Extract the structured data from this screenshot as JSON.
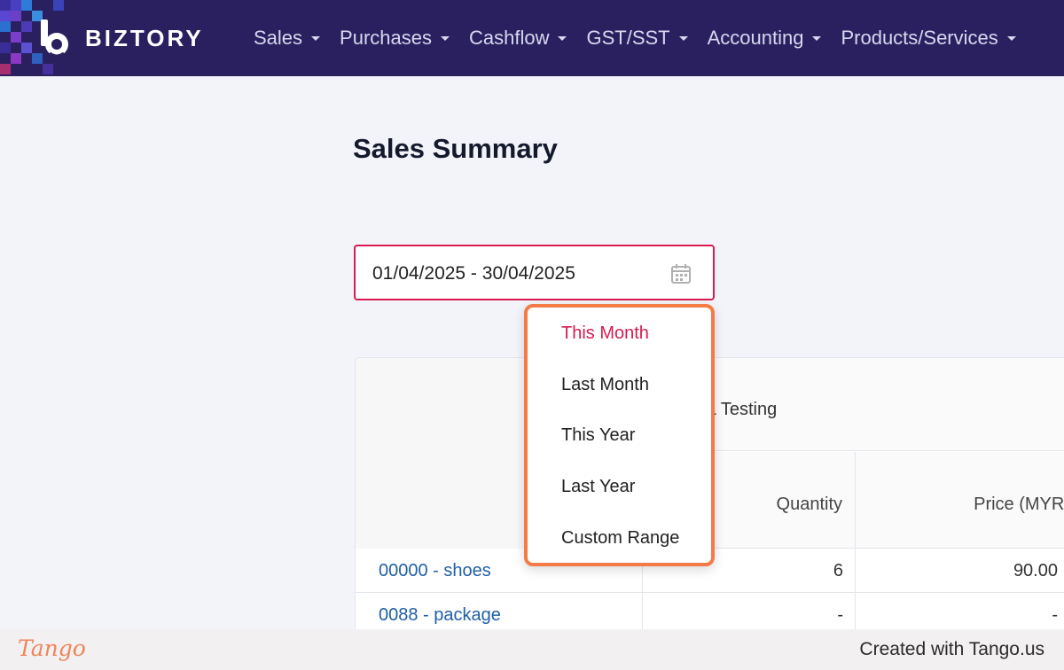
{
  "app": {
    "brand": "BIZTORY",
    "colors": {
      "nav_bg": "#2a2060",
      "accent": "#d81b4f",
      "highlight_border": "#f47b45",
      "link": "#1f5fa8"
    }
  },
  "nav": {
    "items": [
      {
        "label": "Sales"
      },
      {
        "label": "Purchases"
      },
      {
        "label": "Cashflow"
      },
      {
        "label": "GST/SST"
      },
      {
        "label": "Accounting"
      },
      {
        "label": "Products/Services"
      }
    ]
  },
  "page": {
    "title": "Sales Summary"
  },
  "date_range": {
    "value": "01/04/2025 - 30/04/2025",
    "icon": "calendar-icon"
  },
  "dropdown": {
    "options": [
      {
        "label": "This Month",
        "active": true
      },
      {
        "label": "Last Month"
      },
      {
        "label": "This Year"
      },
      {
        "label": "Last Year"
      },
      {
        "label": "Custom Range"
      }
    ]
  },
  "table": {
    "company_partial": "ta Testing",
    "columns": {
      "quantity": "Quantity",
      "price": "Price (MYR)"
    },
    "rows": [
      {
        "item": "00000 - shoes",
        "quantity": "6",
        "price": "90.00"
      },
      {
        "item": "0088 - package",
        "quantity": "-",
        "price": "-"
      }
    ]
  },
  "footer": {
    "tango": "Tango",
    "created": "Created with Tango.us"
  }
}
